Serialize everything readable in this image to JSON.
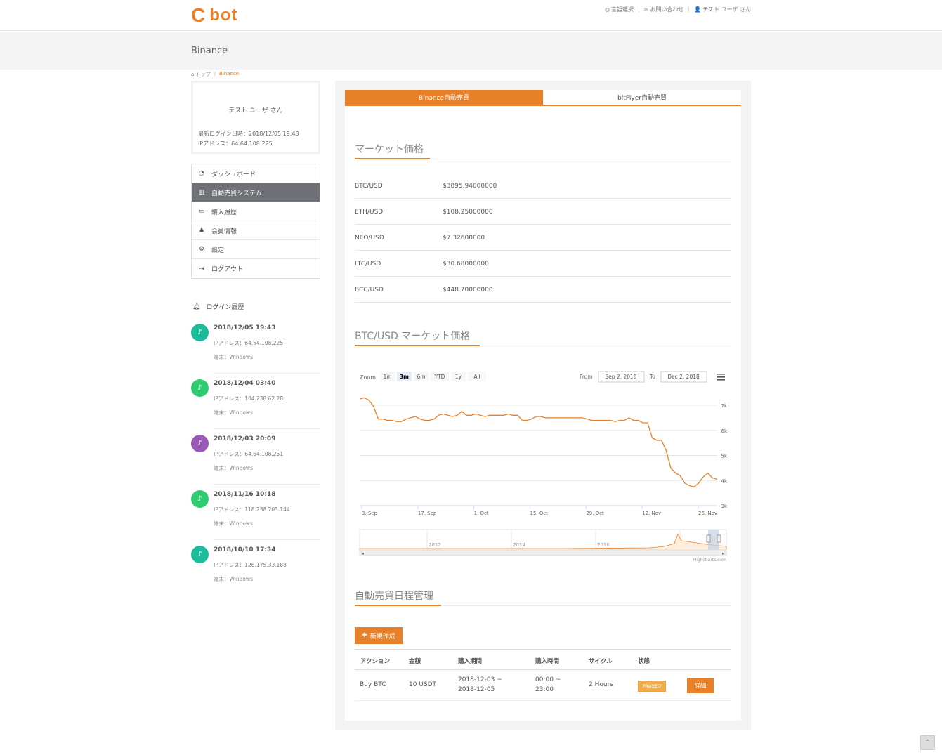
{
  "header": {
    "logo_c": "C",
    "logo_text": "bot",
    "links": [
      "言語選択",
      "お問い合わせ",
      "テスト ユーザ さん"
    ]
  },
  "page_title": "Binance",
  "breadcrumb": [
    "トップ",
    "Binance"
  ],
  "profile": {
    "name": "テスト ユーザ さん",
    "last_login": "最新ログイン日時：2018/12/05 19:43",
    "ip": "IPアドレス：64.64.108.225"
  },
  "menu": [
    {
      "label": "ダッシュボード",
      "icon": "dashboard-icon"
    },
    {
      "label": "自動売買システム",
      "icon": "bar-chart-icon",
      "active": true
    },
    {
      "label": "購入履歴",
      "icon": "card-icon"
    },
    {
      "label": "会員情報",
      "icon": "user-icon"
    },
    {
      "label": "設定",
      "icon": "gear-icon"
    },
    {
      "label": "ログアウト",
      "icon": "signout-icon"
    }
  ],
  "login_history": {
    "title": "ログイン履歴",
    "items": [
      {
        "time": "2018/12/05 19:43",
        "ip": "IPアドレス：64.64.108.225",
        "device": "端末：Windows",
        "color": "#1abc9c"
      },
      {
        "time": "2018/12/04 03:40",
        "ip": "IPアドレス：104.238.62.28",
        "device": "端末：Windows",
        "color": "#2ecc71"
      },
      {
        "time": "2018/12/03 20:09",
        "ip": "IPアドレス：64.64.108.251",
        "device": "端末：Windows",
        "color": "#9b59b6"
      },
      {
        "time": "2018/11/16 10:18",
        "ip": "IPアドレス：118.238.203.144",
        "device": "端末：Windows",
        "color": "#2ecc71"
      },
      {
        "time": "2018/10/10 17:34",
        "ip": "IPアドレス：126.175.33.188",
        "device": "端末：Windows",
        "color": "#1abc9c"
      }
    ]
  },
  "tabs": [
    {
      "label": "Binance自動売買",
      "active": true
    },
    {
      "label": "bitFlyer自動売買",
      "active": false
    }
  ],
  "market": {
    "title": "マーケット価格",
    "rows": [
      {
        "pair": "BTC/USD",
        "price": "$3895.94000000"
      },
      {
        "pair": "ETH/USD",
        "price": "$108.25000000"
      },
      {
        "pair": "NEO/USD",
        "price": "$7.32600000"
      },
      {
        "pair": "LTC/USD",
        "price": "$30.68000000"
      },
      {
        "pair": "BCC/USD",
        "price": "$448.70000000"
      }
    ]
  },
  "btc_chart": {
    "title": "BTC/USD マーケット価格",
    "zoom_label": "Zoom",
    "zoom_buttons": [
      "1m",
      "3m",
      "6m",
      "YTD",
      "1y",
      "All"
    ],
    "zoom_active": "3m",
    "from_label": "From",
    "from_value": "Sep 2, 2018",
    "to_label": "To",
    "to_value": "Dec 2, 2018",
    "credit": "Highcharts.com"
  },
  "chart_data": {
    "type": "line",
    "x_ticks": [
      "3. Sep",
      "17. Sep",
      "1. Oct",
      "15. Oct",
      "29. Oct",
      "12. Nov",
      "26. Nov"
    ],
    "y_ticks": [
      "3k",
      "4k",
      "5k",
      "6k",
      "7k"
    ],
    "ylim": [
      3000,
      7000
    ],
    "navigator_ticks": [
      "2012",
      "2014",
      "2016",
      "2018"
    ],
    "series": [
      {
        "values": [
          7250,
          7300,
          7200,
          6950,
          6450,
          6450,
          6400,
          6400,
          6350,
          6350,
          6450,
          6500,
          6550,
          6450,
          6400,
          6400,
          6450,
          6600,
          6650,
          6600,
          6550,
          6600,
          6750,
          6600,
          6600,
          6650,
          6600,
          6550,
          6600,
          6600,
          6600,
          6600,
          6650,
          6600,
          6600,
          6400,
          6400,
          6450,
          6550,
          6550,
          6500,
          6500,
          6500,
          6500,
          6500,
          6500,
          6500,
          6500,
          6500,
          6450,
          6400,
          6400,
          6400,
          6400,
          6400,
          6350,
          6400,
          6400,
          6500,
          6400,
          6400,
          6300,
          6300,
          5700,
          5600,
          5600,
          5200,
          4500,
          4300,
          4200,
          3900,
          3800,
          3750,
          3900,
          4150,
          4300,
          4100,
          4050
        ]
      }
    ]
  },
  "schedule": {
    "title": "自動売買日程管理",
    "new_button": "新規作成",
    "headers": [
      "アクション",
      "金額",
      "購入期間",
      "購入時間",
      "サイクル",
      "状態"
    ],
    "rows": [
      {
        "action": "Buy BTC",
        "amount": "10 USDT",
        "period_from": "2018-12-03 ~",
        "period_to": "2018-12-05",
        "time_from": "00:00 ~",
        "time_to": "23:00",
        "cycle": "2 Hours",
        "status": "PAUSED",
        "detail": "詳細"
      }
    ]
  },
  "colors": {
    "accent": "#e8802a",
    "menu_active": "#6f7177",
    "badge": "#f0ad4e"
  }
}
